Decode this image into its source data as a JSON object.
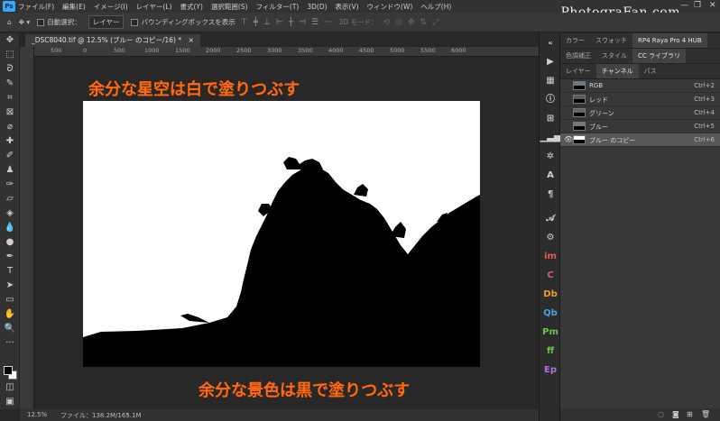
{
  "menubar": {
    "logo": "Ps",
    "items": [
      "ファイル(F)",
      "編集(E)",
      "イメージ(I)",
      "レイヤー(L)",
      "書式(Y)",
      "選択範囲(S)",
      "フィルター(T)",
      "3D(D)",
      "表示(V)",
      "ウィンドウ(W)",
      "ヘルプ(H)"
    ],
    "watermark": "PhotograFan.com",
    "controls": [
      "—",
      "❐",
      "✕"
    ]
  },
  "options": {
    "home_icon": "home-icon",
    "move_icon": "move-icon",
    "auto_select_label": "自動選択：",
    "layer_dropdown": "レイヤー",
    "bounding_box_label": "バウンディングボックスを表示",
    "mode_3d_label": "3D モード："
  },
  "document": {
    "tab_title": "_DSC8040.tif @ 12.5% (ブルー のコピー/16) *",
    "close": "×"
  },
  "rulers": {
    "top_ticks": [
      "500",
      "0",
      "500",
      "1000",
      "1500",
      "2000",
      "2500",
      "3000",
      "3500",
      "4000",
      "4500",
      "5000",
      "5500",
      "6000"
    ]
  },
  "annotations": {
    "top": "余分な星空は白で塗りつぶす",
    "bottom": "余分な景色は黒で塗りつぶす"
  },
  "status": {
    "zoom": "12.5%",
    "file_info": "ファイル：138.2M/165.1M"
  },
  "panel": {
    "top_tabs": [
      "カラー",
      "スウォッチ",
      "RP4 Raya Pro 4 HUB"
    ],
    "mid_tabs": [
      "色調補正",
      "スタイル",
      "CC ライブラリ"
    ],
    "tabs": [
      "レイヤー",
      "チャンネル",
      "パス"
    ],
    "active_tab": "チャンネル",
    "channels": [
      {
        "name": "RGB",
        "key": "Ctrl+2",
        "visible": false,
        "selected": false
      },
      {
        "name": "レッド",
        "key": "Ctrl+3",
        "visible": false,
        "selected": false
      },
      {
        "name": "グリーン",
        "key": "Ctrl+4",
        "visible": false,
        "selected": false
      },
      {
        "name": "ブルー",
        "key": "Ctrl+5",
        "visible": false,
        "selected": false
      },
      {
        "name": "ブルー のコピー",
        "key": "Ctrl+6",
        "visible": true,
        "selected": true
      }
    ]
  },
  "plugin_strip": [
    "A",
    "¶",
    "𝒜",
    "im",
    "C",
    "Db",
    "Qb",
    "Pm",
    "ff",
    "Ep"
  ],
  "colors": {
    "annotation": "#ff6a13",
    "foreground": "#000000",
    "background": "#ffffff"
  }
}
